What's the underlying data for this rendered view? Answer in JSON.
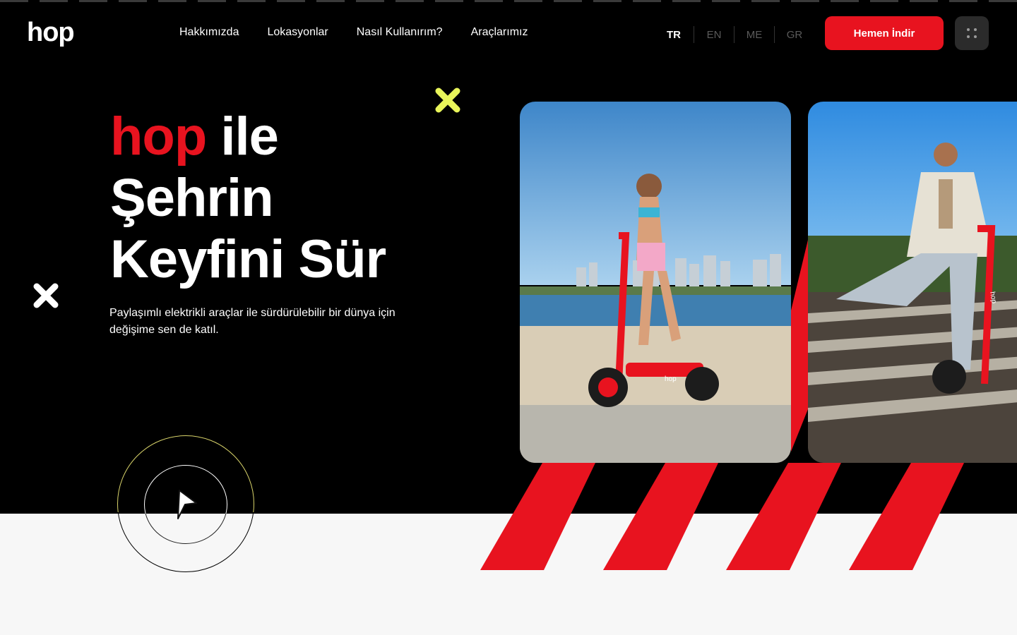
{
  "header": {
    "logo_text": "hop",
    "nav": [
      {
        "label": "Hakkımızda"
      },
      {
        "label": "Lokasyonlar"
      },
      {
        "label": "Nasıl Kullanırım?"
      },
      {
        "label": "Araçlarımız"
      }
    ],
    "languages": [
      {
        "code": "TR",
        "active": true
      },
      {
        "code": "EN",
        "active": false
      },
      {
        "code": "ME",
        "active": false
      },
      {
        "code": "GR",
        "active": false
      }
    ],
    "cta_label": "Hemen İndir",
    "menu_icon": "grid-dots-icon"
  },
  "hero": {
    "headline_brand": "hop",
    "headline_line1_rest": " ile",
    "headline_line2": "Şehrin",
    "headline_line3": "Keyfini Sür",
    "subtitle": "Paylaşımlı elektrikli araçlar ile sürdürülebilir bir dünya için değişime sen de katıl.",
    "play_icon": "play-icon",
    "photos": [
      {
        "scooter_brand": "hop"
      },
      {
        "scooter_brand": "hop"
      }
    ]
  },
  "colors": {
    "brand_red": "#e8131f",
    "accent_yellow": "#e9f55a",
    "background_dark": "#000000",
    "background_light": "#f7f7f7"
  }
}
